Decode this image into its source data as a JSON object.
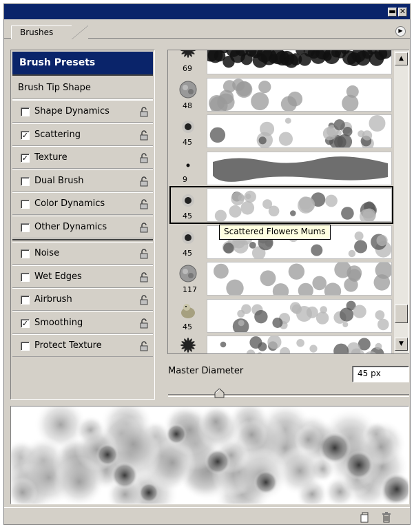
{
  "window": {
    "min_glyph": "▬",
    "close_glyph": "✕"
  },
  "tabs": [
    {
      "label": "Brushes"
    }
  ],
  "menu_icon": "flyout-menu-icon",
  "left_panel": {
    "header": "Brush Presets",
    "tip_shape": "Brush Tip Shape",
    "options": [
      {
        "label": "Shape Dynamics",
        "checked": false
      },
      {
        "label": "Scattering",
        "checked": true
      },
      {
        "label": "Texture",
        "checked": true
      },
      {
        "label": "Dual Brush",
        "checked": false
      },
      {
        "label": "Color Dynamics",
        "checked": false
      },
      {
        "label": "Other Dynamics",
        "checked": false
      },
      {
        "label": "Noise",
        "checked": false
      },
      {
        "label": "Wet Edges",
        "checked": false
      },
      {
        "label": "Airbrush",
        "checked": false
      },
      {
        "label": "Smoothing",
        "checked": true
      },
      {
        "label": "Protect Texture",
        "checked": false
      }
    ]
  },
  "brush_list": {
    "items": [
      {
        "size": "69"
      },
      {
        "size": "48"
      },
      {
        "size": "45"
      },
      {
        "size": "9"
      },
      {
        "size": "45",
        "selected": true
      },
      {
        "size": "45"
      },
      {
        "size": "117"
      },
      {
        "size": "45"
      },
      {
        "size": ""
      }
    ],
    "tooltip": "Scattered Flowers Mums"
  },
  "master_diameter": {
    "label": "Master Diameter",
    "value": "45 px",
    "slider_fraction": 0.22
  },
  "colors": {
    "title_bar": "#0a246a",
    "panel_bg": "#d4d0c8",
    "tooltip_bg": "#ffffe1"
  }
}
